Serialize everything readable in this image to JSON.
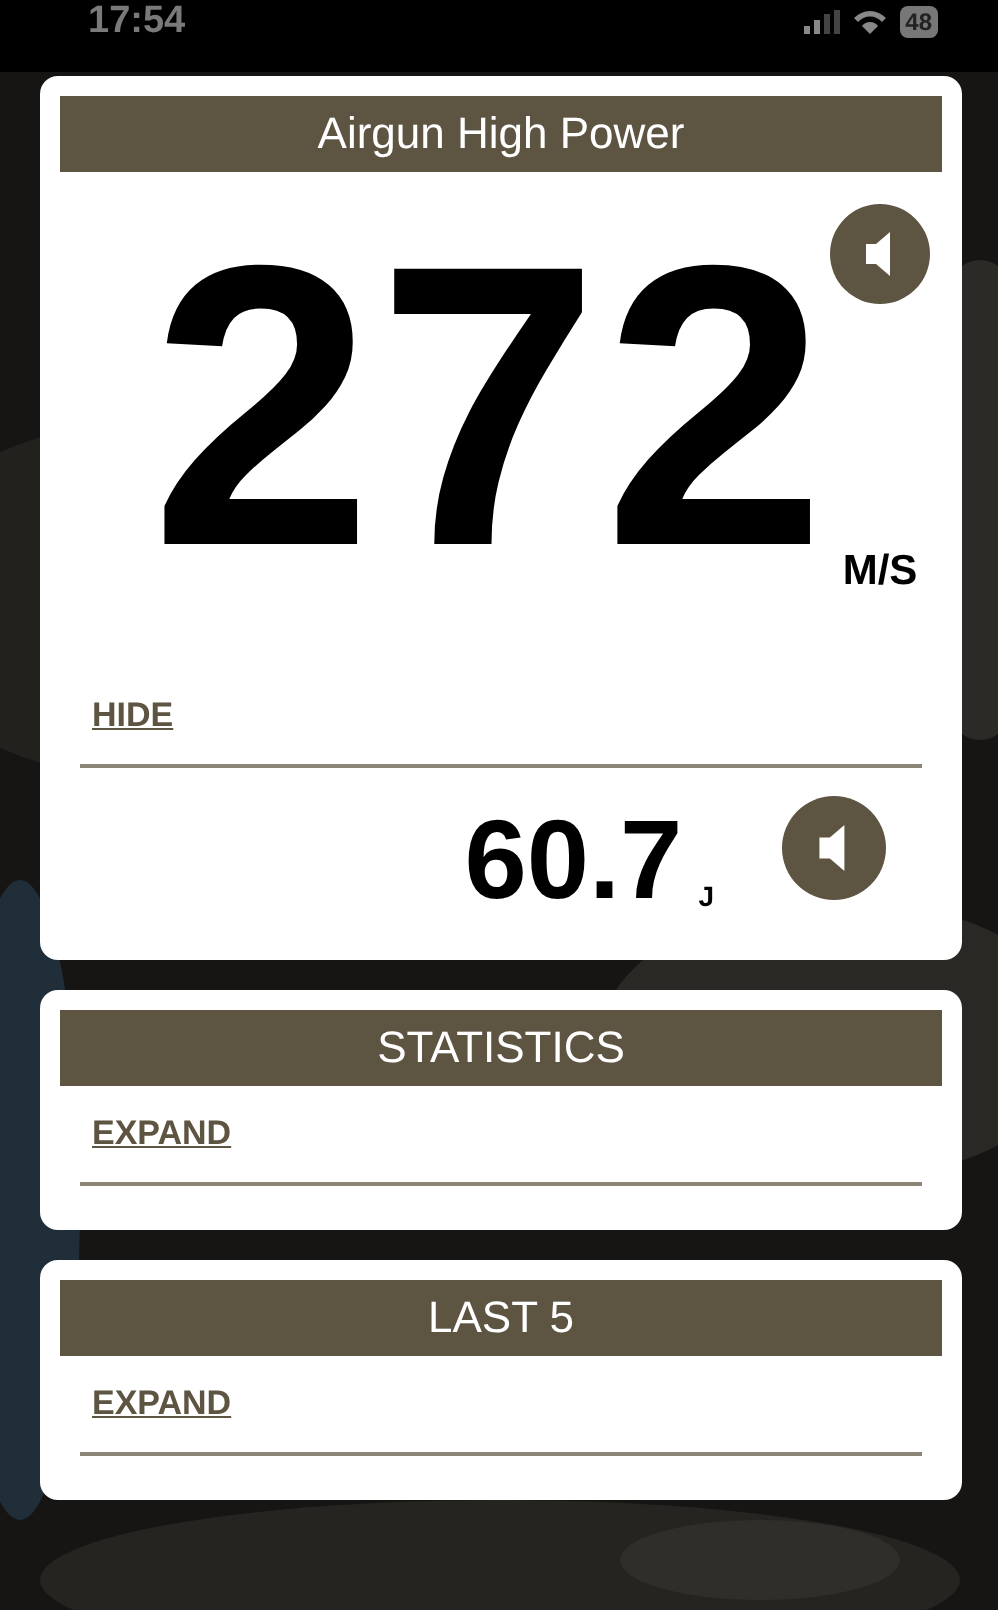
{
  "status_bar": {
    "time": "17:54",
    "battery": "48"
  },
  "main_panel": {
    "title": "Airgun High Power",
    "velocity": "272",
    "velocity_unit": "M/S",
    "toggle": "HIDE",
    "energy": "60.7",
    "energy_unit": "J"
  },
  "sections": [
    {
      "title": "STATISTICS",
      "toggle": "EXPAND"
    },
    {
      "title": "LAST 5",
      "toggle": "EXPAND"
    }
  ]
}
